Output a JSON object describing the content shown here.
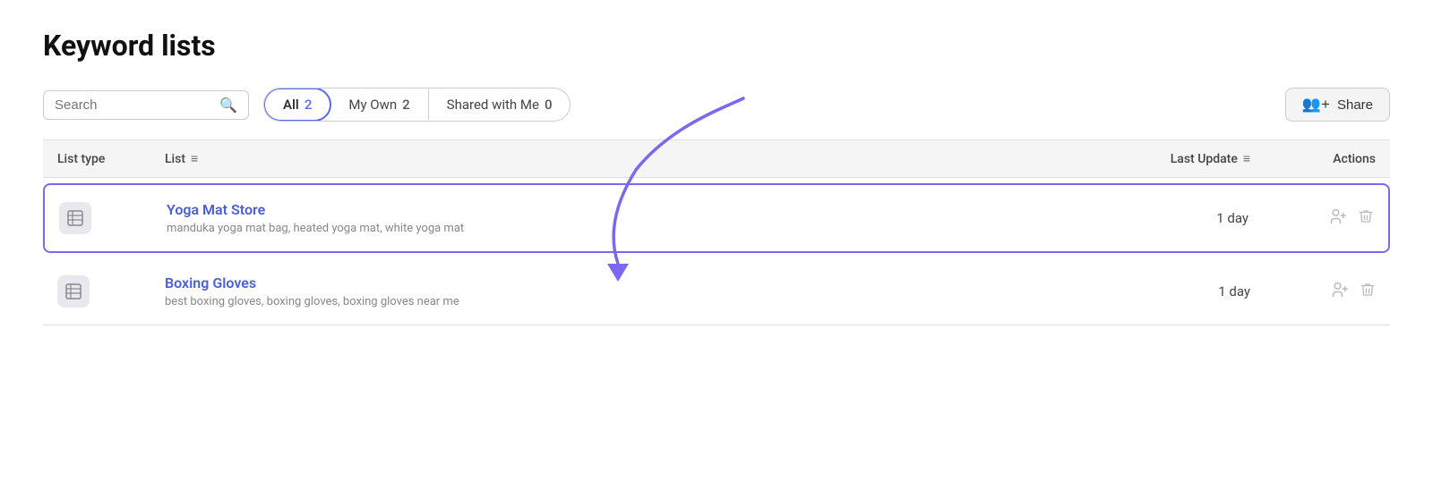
{
  "page": {
    "title": "Keyword lists"
  },
  "toolbar": {
    "search_placeholder": "Search",
    "share_label": "Share"
  },
  "tabs": [
    {
      "id": "all",
      "label": "All",
      "count": "2",
      "active": true
    },
    {
      "id": "my-own",
      "label": "My Own",
      "count": "2",
      "active": false
    },
    {
      "id": "shared-with-me",
      "label": "Shared with Me",
      "count": "0",
      "active": false
    }
  ],
  "table": {
    "headers": [
      {
        "id": "list-type",
        "label": "List type"
      },
      {
        "id": "list",
        "label": "List"
      },
      {
        "id": "last-update",
        "label": "Last Update"
      },
      {
        "id": "actions",
        "label": "Actions"
      }
    ],
    "rows": [
      {
        "id": "yoga-mat-store",
        "highlighted": true,
        "name": "Yoga Mat Store",
        "keywords": "manduka yoga mat bag, heated yoga mat, white yoga mat",
        "last_update": "1 day"
      },
      {
        "id": "boxing-gloves",
        "highlighted": false,
        "name": "Boxing Gloves",
        "keywords": "best boxing gloves, boxing gloves, boxing gloves near me",
        "last_update": "1 day"
      }
    ]
  },
  "icons": {
    "search": "&#128269;",
    "share": "&#128101;",
    "table": "&#9783;",
    "filter": "&#8801;",
    "add_user": "&#43;",
    "delete": "&#128465;"
  }
}
